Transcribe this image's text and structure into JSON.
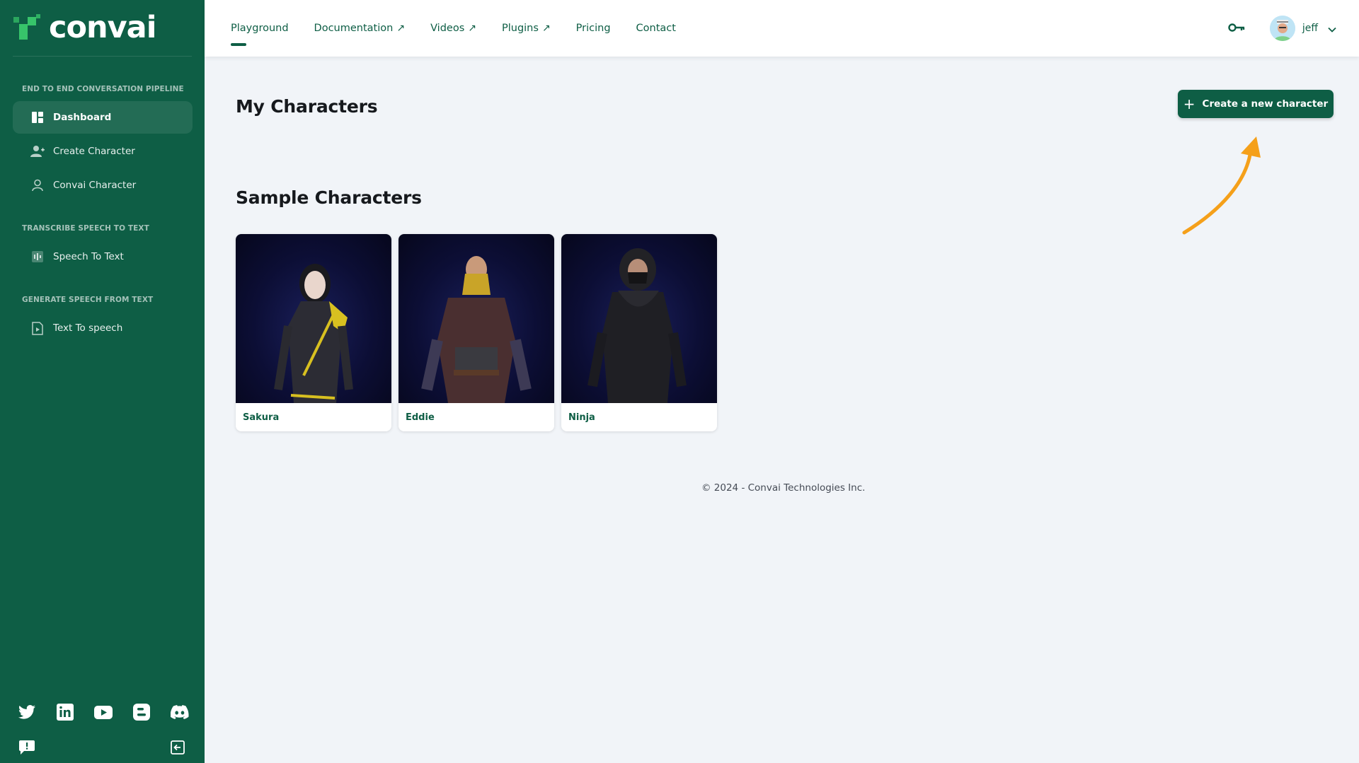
{
  "app": {
    "logo_text": "convai"
  },
  "sidebar": {
    "sections": [
      {
        "label": "END TO END CONVERSATION PIPELINE"
      },
      {
        "label": "TRANSCRIBE SPEECH TO TEXT"
      },
      {
        "label": "GENERATE SPEECH FROM TEXT"
      }
    ],
    "items": [
      {
        "label": "Dashboard",
        "icon": "dashboard-icon",
        "active": true
      },
      {
        "label": "Create Character",
        "icon": "user-plus-icon"
      },
      {
        "label": "Convai Character",
        "icon": "user-outline-icon"
      },
      {
        "label": "Speech To Text",
        "icon": "waveform-icon"
      },
      {
        "label": "Text To speech",
        "icon": "document-play-icon"
      }
    ],
    "socials": [
      "twitter-icon",
      "linkedin-icon",
      "youtube-icon",
      "blogger-icon",
      "discord-icon"
    ]
  },
  "topnav": {
    "links": [
      {
        "label": "Playground",
        "active": true
      },
      {
        "label": "Documentation",
        "external": true
      },
      {
        "label": "Videos",
        "external": true
      },
      {
        "label": "Plugins",
        "external": true
      },
      {
        "label": "Pricing"
      },
      {
        "label": "Contact"
      }
    ],
    "external_arrow": "↗",
    "user": {
      "name": "jeff"
    }
  },
  "main": {
    "my_characters_title": "My Characters",
    "create_button_label": "Create a new character",
    "sample_title": "Sample Characters",
    "characters": [
      {
        "name": "Sakura"
      },
      {
        "name": "Eddie"
      },
      {
        "name": "Ninja"
      }
    ],
    "footer": "© 2024 - Convai Technologies Inc."
  },
  "colors": {
    "brand": "#0e5e45",
    "accent_green": "#37c46a",
    "hint_arrow": "#f5a01a"
  }
}
